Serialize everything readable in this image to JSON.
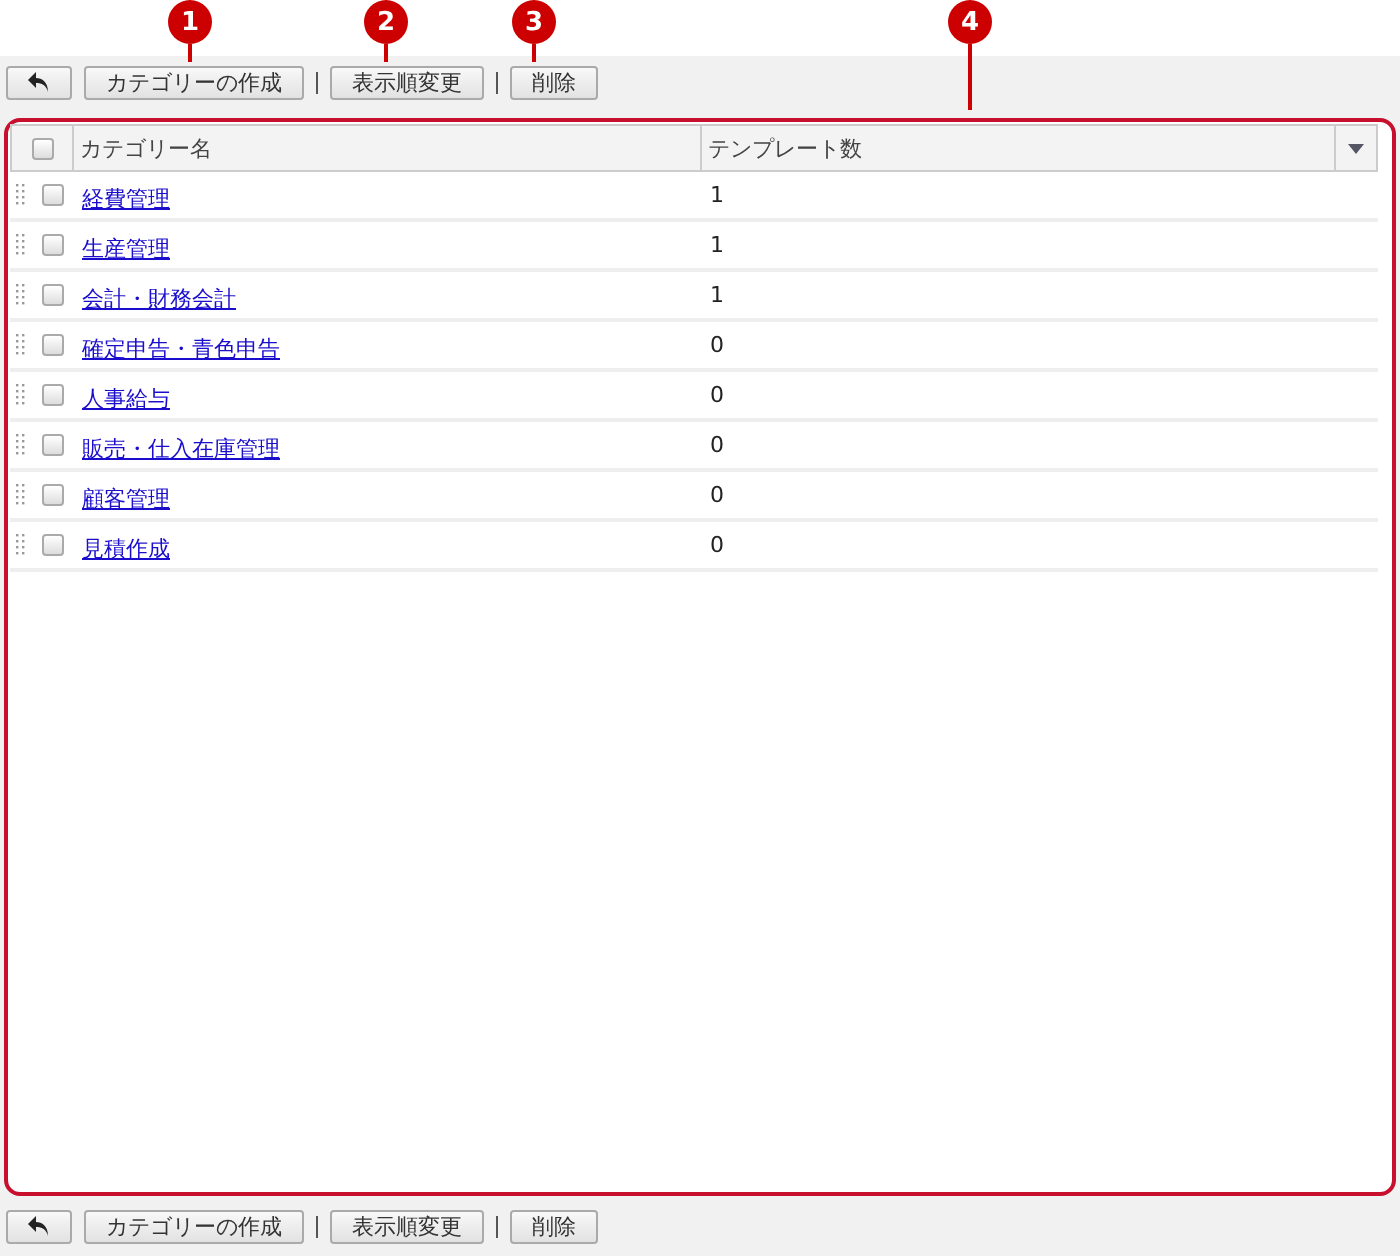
{
  "callouts": [
    "1",
    "2",
    "3",
    "4"
  ],
  "top_toolbar": [
    "カテゴリーの作成",
    "表示順変更",
    "削除"
  ],
  "table": {
    "header_checked": false,
    "columns": [
      "カテゴリー名",
      "テンプレート数"
    ],
    "rows": [
      {
        "name": "経費管理",
        "count": "1",
        "checked": false
      },
      {
        "name": "生産管理",
        "count": "1",
        "checked": false
      },
      {
        "name": "会計・財務会計",
        "count": "1",
        "checked": false
      },
      {
        "name": "確定申告・青色申告",
        "count": "0",
        "checked": false
      },
      {
        "name": "人事給与",
        "count": "0",
        "checked": false
      },
      {
        "name": "販売・仕入在庫管理",
        "count": "0",
        "checked": false
      },
      {
        "name": "顧客管理",
        "count": "0",
        "checked": false
      },
      {
        "name": "見積作成",
        "count": "0",
        "checked": false
      }
    ]
  },
  "bottom_toolbar": [
    "カテゴリーの作成",
    "表示順変更",
    "削除"
  ]
}
